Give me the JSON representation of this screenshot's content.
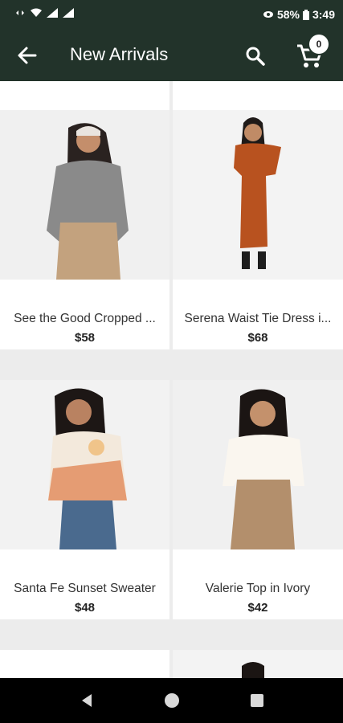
{
  "status_bar": {
    "battery": "58%",
    "time": "3:49"
  },
  "app_bar": {
    "title": "New Arrivals",
    "cart_count": "0"
  },
  "products": [
    {
      "name": "See the Good Cropped ...",
      "price": "$58",
      "image": "woman in grey cropped sweatshirt and tan trousers"
    },
    {
      "name": "Serena Waist Tie Dress i...",
      "price": "$68",
      "image": "woman in rust waist-tie dress and black boots"
    },
    {
      "name": "Santa Fe Sunset Sweater",
      "price": "$48",
      "image": "woman in colorblock sunset sweater and ripped jeans"
    },
    {
      "name": "Valerie Top in Ivory",
      "price": "$42",
      "image": "woman in ivory top and tan wide-leg pants"
    }
  ],
  "icons": {
    "back": "arrow-left-icon",
    "search": "search-icon",
    "cart": "cart-icon",
    "nav_back": "triangle-back-icon",
    "nav_home": "circle-home-icon",
    "nav_recents": "square-recents-icon"
  }
}
